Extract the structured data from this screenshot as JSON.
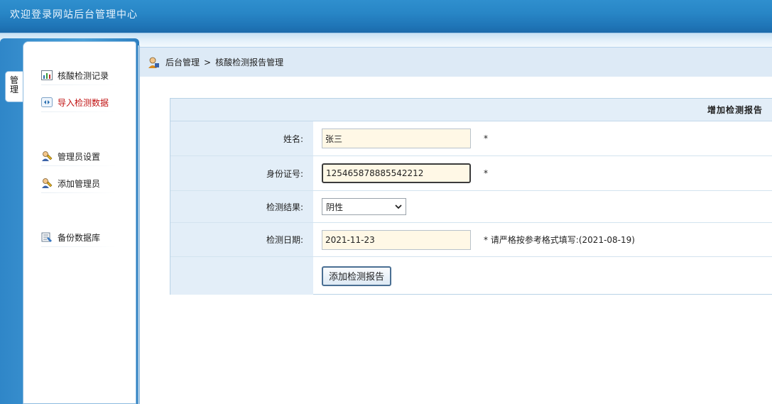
{
  "header": {
    "title": "欢迎登录网站后台管理中心"
  },
  "sidebar": {
    "tab_label": "管理",
    "items": [
      {
        "label": "核酸检测记录",
        "icon": "bar-chart-icon",
        "active": false
      },
      {
        "label": "导入检测数据",
        "icon": "import-icon",
        "active": true
      },
      {
        "label": "管理员设置",
        "icon": "admin-user-icon",
        "active": false
      },
      {
        "label": "添加管理员",
        "icon": "admin-user-icon",
        "active": false
      },
      {
        "label": "备份数据库",
        "icon": "backup-icon",
        "active": false
      }
    ]
  },
  "breadcrumb": {
    "root": "后台管理",
    "separator": ">",
    "current": "核酸检测报告管理"
  },
  "form": {
    "header": "增加检测报告",
    "name": {
      "label": "姓名:",
      "value": "张三",
      "required": "*"
    },
    "id_number": {
      "label": "身份证号:",
      "value": "125465878885542212",
      "required": "*"
    },
    "result": {
      "label": "检测结果:",
      "selected": "阴性"
    },
    "date": {
      "label": "检测日期:",
      "value": "2021-11-23",
      "hint": "* 请严格按参考格式填写:(2021-08-19)"
    },
    "submit_label": "添加检测报告"
  },
  "colors": {
    "header": "#2886c6",
    "active_menu": "#c01010",
    "label_bg": "#e3eef8",
    "input_bg": "#fff8e6"
  }
}
